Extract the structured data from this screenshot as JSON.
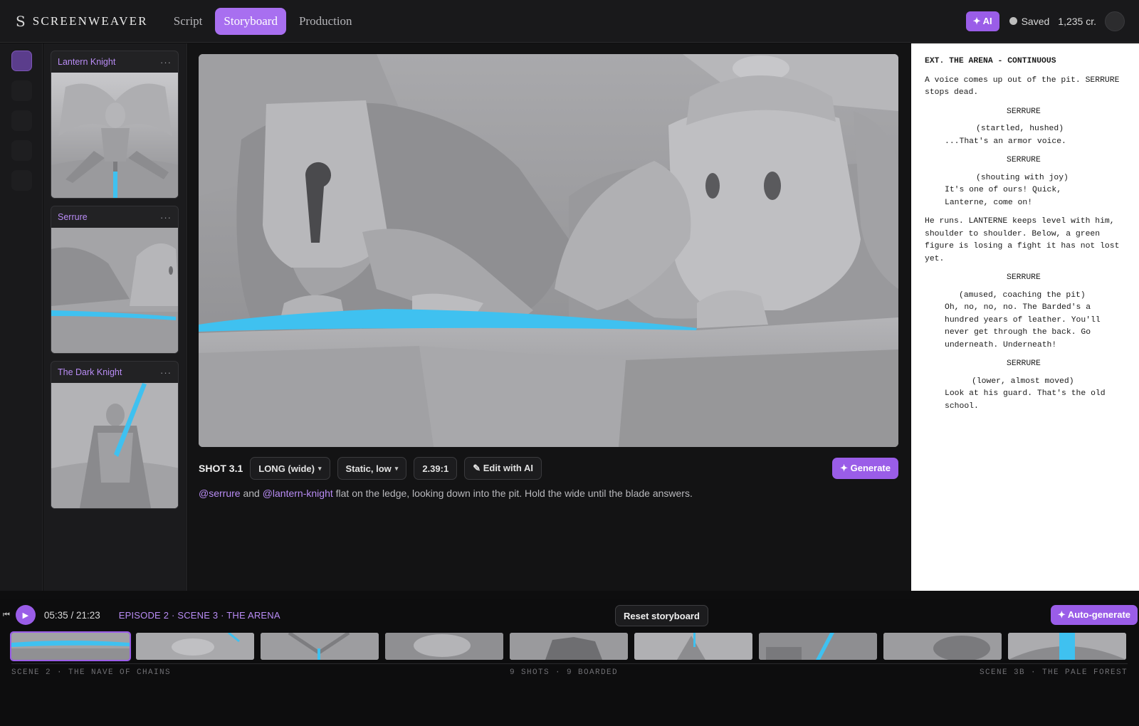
{
  "app": {
    "name": "SCREENWEAVER",
    "logo_glyph": "S"
  },
  "nav": {
    "tabs": [
      {
        "label": "Script",
        "active": false
      },
      {
        "label": "Storyboard",
        "active": true
      },
      {
        "label": "Production",
        "active": false
      }
    ]
  },
  "status": {
    "ai_label": "✦ AI",
    "saved_label": "Saved",
    "credits": "1,235 cr."
  },
  "characters": [
    {
      "name": "Lantern Knight",
      "more": "···"
    },
    {
      "name": "Serrure",
      "more": "···"
    },
    {
      "name": "The Dark Knight",
      "more": "···"
    }
  ],
  "shot": {
    "label": "SHOT 3.1",
    "framing": "LONG (wide)",
    "camera": "Static, low",
    "aspect": "2.39:1",
    "edit_label": "✎ Edit with AI",
    "generate_label": "✦ Generate",
    "desc_mention_1": "@serrure",
    "desc_and": " and ",
    "desc_mention_2": "@lantern-knight",
    "desc_rest": " flat on the ledge, looking down into the pit. Hold the wide until the blade answers."
  },
  "script": {
    "heading": "EXT. THE ARENA - CONTINUOUS",
    "action_1": "A voice comes up out of the pit. SERRURE stops dead.",
    "char_1": "SERRURE",
    "paren_1": "(startled, hushed)",
    "dialog_1": "...That's an armor voice.",
    "char_2": "SERRURE",
    "paren_2": "(shouting with joy)",
    "dialog_2": "It's one of ours! Quick, Lanterne, come on!",
    "action_2": "He runs. LANTERNE keeps level with him, shoulder to shoulder. Below, a green figure is losing a fight it has not lost yet.",
    "char_3": "SERRURE",
    "paren_3": "(amused, coaching the pit)",
    "dialog_3": "Oh, no, no, no. The Barded's a hundred years of leather. You'll never get through the back. Go underneath. Underneath!",
    "char_4": "SERRURE",
    "paren_4": "(lower, almost moved)",
    "dialog_4": "Look at his guard. That's the old school."
  },
  "timeline": {
    "time": "05:35 / 21:23",
    "scene_title": "EPISODE 2 · SCENE 3 · THE ARENA",
    "reset_label": "Reset storyboard",
    "autogen_label": "✦ Auto-generate",
    "label_left": "SCENE 2 · THE NAVE OF CHAINS",
    "label_center": "9 SHOTS · 9 BOARDED",
    "label_right": "SCENE 3B · THE PALE FOREST"
  },
  "colors": {
    "accent": "#9a5de8",
    "blade": "#3fc1f0",
    "mention": "#b98cf5"
  }
}
